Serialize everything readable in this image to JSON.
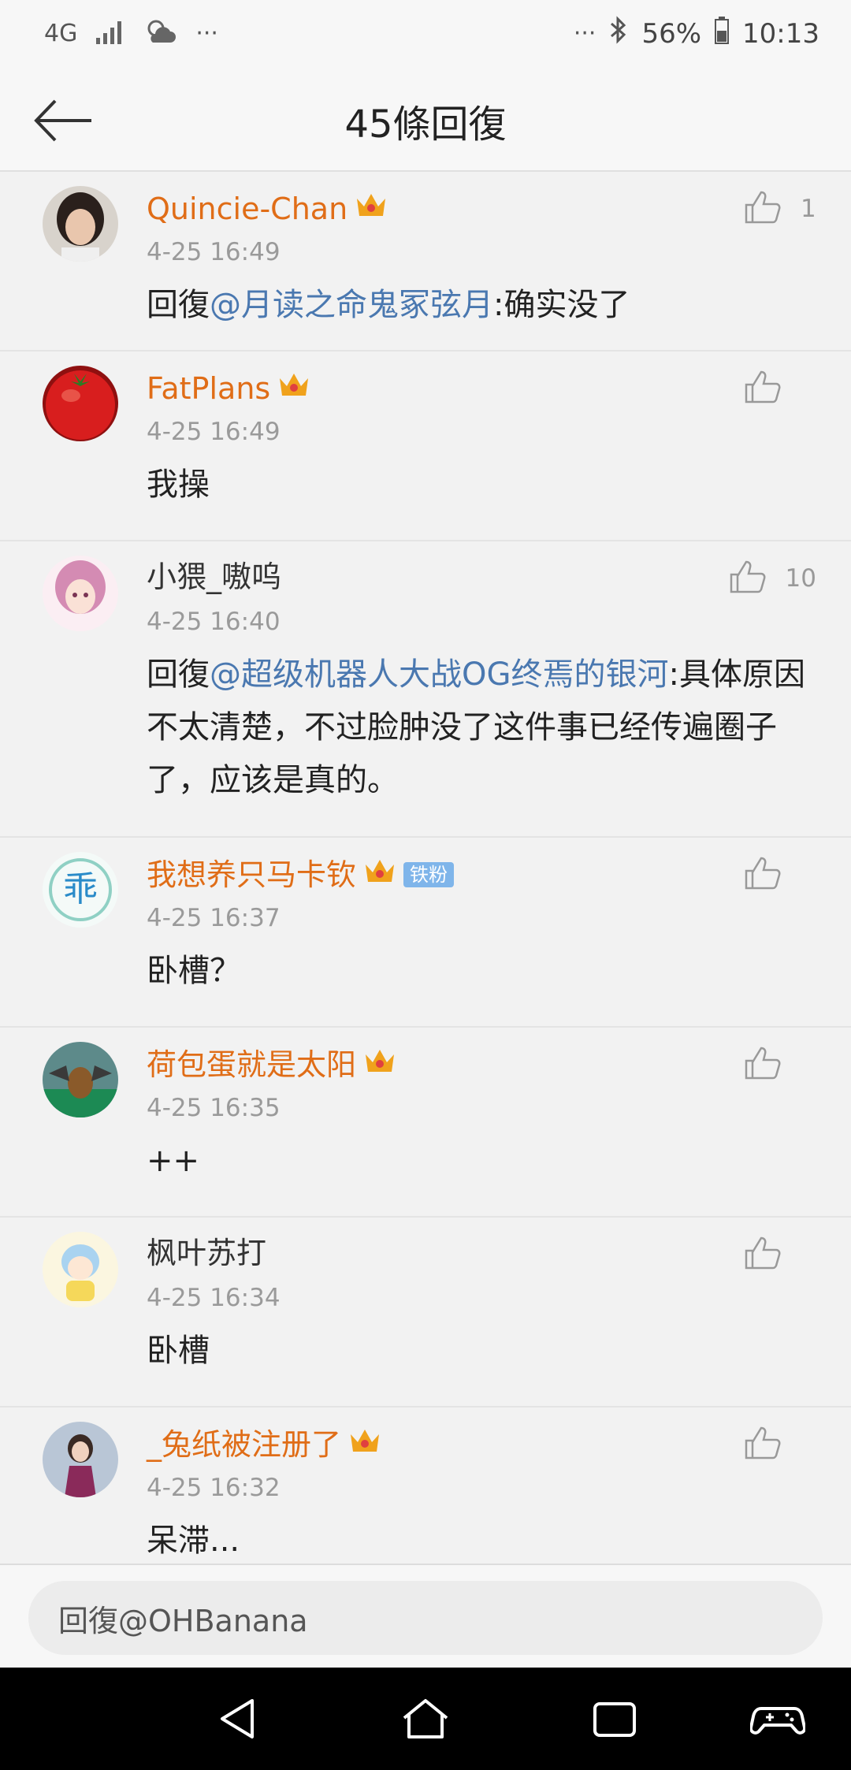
{
  "status_bar": {
    "network": "4G",
    "more": "···",
    "more_right": "···",
    "battery_percent": "56%",
    "time": "10:13"
  },
  "header": {
    "title": "45條回復"
  },
  "comments": [
    {
      "username": "Quincie-Chan",
      "time": "4-25 16:49",
      "reply_prefix": "回復",
      "mention": "@月读之命鬼冢弦月",
      "text": ":确实没了",
      "like_count": "1"
    },
    {
      "username": "FatPlans",
      "time": "4-25 16:49",
      "reply_prefix": "",
      "mention": "",
      "text": "我操",
      "like_count": ""
    },
    {
      "username": "小猥_嗷呜",
      "time": "4-25 16:40",
      "reply_prefix": "回復",
      "mention": "@超级机器人大战OG终焉的银河",
      "text": ":具体原因不太清楚，不过脸肿没了这件事已经传遍圈子了，应该是真的。",
      "like_count": "10"
    },
    {
      "username": "我想养只马卡钦",
      "badge": "铁粉",
      "time": "4-25 16:37",
      "reply_prefix": "",
      "mention": "",
      "text": "卧槽？",
      "like_count": ""
    },
    {
      "username": "荷包蛋就是太阳",
      "time": "4-25 16:35",
      "reply_prefix": "",
      "mention": "",
      "text": "++",
      "like_count": ""
    },
    {
      "username": "枫叶苏打",
      "time": "4-25 16:34",
      "reply_prefix": "",
      "mention": "",
      "text": "卧槽",
      "like_count": ""
    },
    {
      "username": "_兔纸被注册了",
      "time": "4-25 16:32",
      "reply_prefix": "",
      "mention": "",
      "text": "呆滞...",
      "like_count": ""
    }
  ],
  "reply_bar": {
    "value": "回復@OHBanana"
  },
  "colors": {
    "username_orange": "#e06d17",
    "mention_blue": "#4a78b0",
    "crown_gold": "#f0a21c",
    "fan_badge": "#7fb5ea"
  }
}
